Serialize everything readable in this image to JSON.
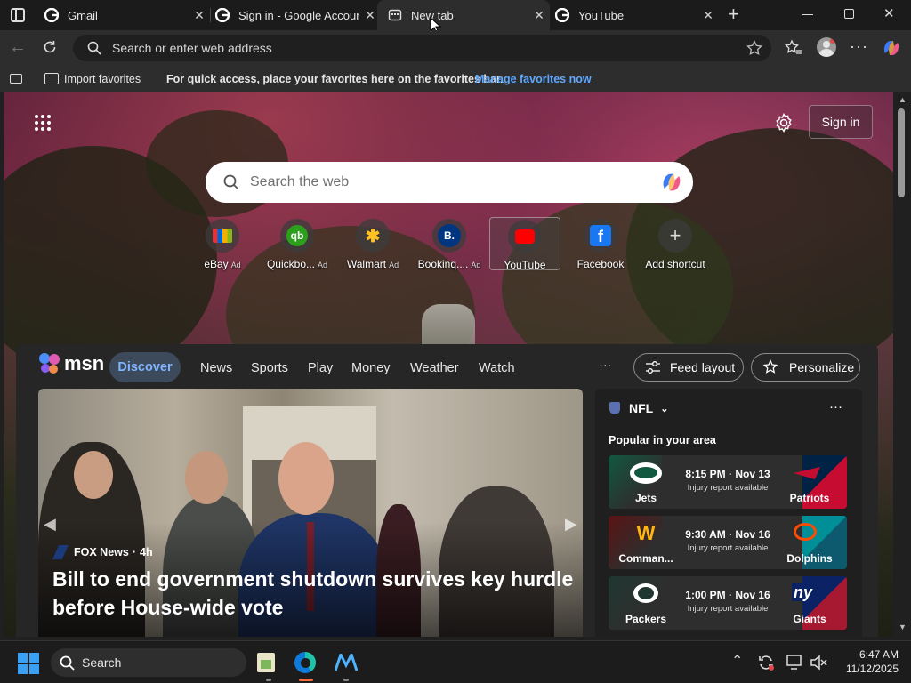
{
  "browser": {
    "tabs": [
      {
        "title": "Gmail",
        "active": false
      },
      {
        "title": "Sign in - Google Accoun",
        "active": false
      },
      {
        "title": "New tab",
        "active": true
      },
      {
        "title": "YouTube",
        "active": false
      }
    ],
    "address_placeholder": "Search or enter web address",
    "favorites_bar": {
      "import_label": "Import favorites",
      "hint": "For quick access, place your favorites here on the favorites bar.",
      "manage_link": "Manage favorites now"
    }
  },
  "newtab": {
    "sign_in": "Sign in",
    "search_placeholder": "Search the web",
    "shortcuts": [
      {
        "label": "eBay",
        "ad": "Ad"
      },
      {
        "label": "Quickbo...",
        "ad": "Ad"
      },
      {
        "label": "Walmart",
        "ad": "Ad"
      },
      {
        "label": "Bookinq....",
        "ad": "Ad"
      },
      {
        "label": "YouTube",
        "ad": ""
      },
      {
        "label": "Facebook",
        "ad": ""
      },
      {
        "label": "Add shortcut",
        "ad": ""
      }
    ]
  },
  "msn": {
    "brand": "msn",
    "nav": [
      "Discover",
      "News",
      "Sports",
      "Play",
      "Money",
      "Weather",
      "Watch"
    ],
    "more": "···",
    "feed_layout": "Feed layout",
    "personalize": "Personalize",
    "hero": {
      "source": "FOX News",
      "age": "4h",
      "headline": "Bill to end government shutdown survives key hurdle before House-wide vote"
    },
    "nfl": {
      "title": "NFL",
      "subtitle": "Popular in your area",
      "injury_text": "Injury report available",
      "games": [
        {
          "home": "Jets",
          "away": "Patriots",
          "time": "8:15 PM · Nov 13"
        },
        {
          "home": "Comman...",
          "away": "Dolphins",
          "time": "9:30 AM · Nov 16"
        },
        {
          "home": "Packers",
          "away": "Giants",
          "time": "1:00 PM · Nov 16"
        }
      ]
    }
  },
  "taskbar": {
    "search_label": "Search",
    "time": "6:47 AM",
    "date": "11/12/2025"
  },
  "colors": {
    "accent_link": "#5ea8ff",
    "msn_panel": "#262626",
    "taskbar": "#1c1c1c"
  }
}
